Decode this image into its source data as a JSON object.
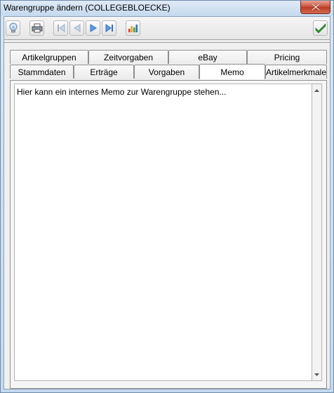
{
  "window": {
    "title": "Warengruppe ändern (COLLEGEBLOECKE)"
  },
  "toolbar": {
    "buttons": [
      {
        "name": "hint-button",
        "icon": "lightbulb-icon"
      },
      {
        "name": "print-button",
        "icon": "printer-icon"
      },
      {
        "name": "first-record-button",
        "icon": "first-icon"
      },
      {
        "name": "previous-record-button",
        "icon": "previous-icon"
      },
      {
        "name": "next-record-button",
        "icon": "next-icon"
      },
      {
        "name": "last-record-button",
        "icon": "last-icon"
      },
      {
        "name": "statistics-button",
        "icon": "bar-chart-icon"
      },
      {
        "name": "save-button",
        "icon": "checkmark-icon"
      }
    ]
  },
  "tabs": {
    "row1": [
      {
        "label": "Artikelgruppen"
      },
      {
        "label": "Zeitvorgaben"
      },
      {
        "label": "eBay"
      },
      {
        "label": "Pricing"
      }
    ],
    "row2": [
      {
        "label": "Stammdaten"
      },
      {
        "label": "Erträge"
      },
      {
        "label": "Vorgaben"
      },
      {
        "label": "Memo"
      },
      {
        "label": "Artikelmerkmale"
      }
    ],
    "active": "Memo"
  },
  "memo": {
    "text": "Hier kann ein internes Memo zur Warengruppe stehen..."
  },
  "colors": {
    "accent_green": "#2e9a2e",
    "close_red": "#c94f3a",
    "nav_blue": "#2f6fc6"
  }
}
